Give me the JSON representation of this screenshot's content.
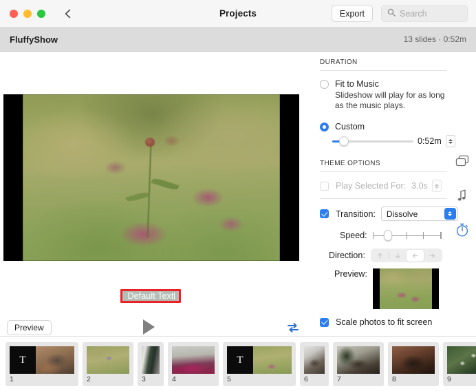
{
  "titlebar": {
    "title": "Projects",
    "back_icon": "chevron-left-icon",
    "export_label": "Export",
    "search_icon": "search-icon",
    "search_placeholder": "Search",
    "search_value": "",
    "window_controls": {
      "close": "close-button",
      "minimize": "minimize-button",
      "zoom": "zoom-button"
    }
  },
  "project_bar": {
    "name": "FluffyShow",
    "meta": "13 slides · 0:52m"
  },
  "stage": {
    "overlay_text": "Default Text",
    "preview_label": "Preview",
    "play_icon": "play-icon",
    "loop_icon": "loop-repeat-icon"
  },
  "sidebar": {
    "duration": {
      "section_label": "DURATION",
      "fit_to_music_label": "Fit to Music",
      "fit_to_music_selected": false,
      "fit_to_music_sub": "Slideshow will play for as long as the music plays.",
      "custom_label": "Custom",
      "custom_selected": true,
      "custom_value": "0:52m"
    },
    "theme_options": {
      "section_label": "THEME OPTIONS",
      "play_selected_label": "Play Selected For:",
      "play_selected_value": "3.0s",
      "play_selected_enabled": false,
      "transition_label": "Transition:",
      "transition_checked": true,
      "transition_value": "Dissolve",
      "transition_options": [
        "Dissolve"
      ],
      "speed_label": "Speed:",
      "direction_label": "Direction:",
      "direction_options": [
        "up-arrow-icon",
        "down-arrow-icon",
        "left-arrow-icon",
        "right-arrow-icon"
      ],
      "direction_selected": "left-arrow-icon",
      "preview_label": "Preview:",
      "scale_label": "Scale photos to fit screen",
      "scale_checked": true
    }
  },
  "rail": {
    "items": [
      {
        "icon": "slides-stack-icon",
        "active": false
      },
      {
        "icon": "music-note-icon",
        "active": false
      },
      {
        "icon": "timer-clock-icon",
        "active": true
      }
    ]
  },
  "filmstrip": {
    "add_icon": "add-slide-icon",
    "slides": [
      {
        "num": "1",
        "has_text_block": true,
        "text_glyph": "T",
        "photo": "cat1"
      },
      {
        "num": "2",
        "has_text_block": false,
        "photo": "field2"
      },
      {
        "num": "3",
        "has_text_block": false,
        "photo": "door3"
      },
      {
        "num": "4",
        "has_text_block": false,
        "photo": "flowers4"
      },
      {
        "num": "5",
        "has_text_block": true,
        "text_glyph": "T",
        "photo": "field5"
      },
      {
        "num": "6",
        "has_text_block": false,
        "photo": "cat6"
      },
      {
        "num": "7",
        "has_text_block": false,
        "photo": "cat7"
      },
      {
        "num": "8",
        "has_text_block": false,
        "photo": "cat8"
      },
      {
        "num": "9",
        "has_text_block": false,
        "photo": "leaves9"
      }
    ]
  },
  "colors": {
    "accent": "#2b7ef0",
    "highlight": "#e8232a",
    "titlebar_bg": "#f6f6f6",
    "projectbar_bg": "#dcdcdc"
  }
}
